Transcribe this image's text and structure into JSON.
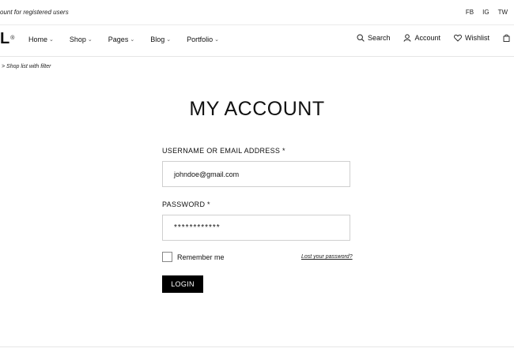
{
  "topbar": {
    "promo": "ount for registered users",
    "social": [
      "FB",
      "IG",
      "TW"
    ]
  },
  "header": {
    "logo": "L",
    "logo_mark": "®",
    "nav": [
      "Home",
      "Shop",
      "Pages",
      "Blog",
      "Portfolio"
    ],
    "chevron": "⌄",
    "search_label": "Search",
    "account_label": "Account",
    "wishlist_label": "Wishlist"
  },
  "breadcrumb": "> Shop list with filter",
  "form": {
    "title": "MY ACCOUNT",
    "username_label": "USERNAME OR EMAIL ADDRESS *",
    "username_value": "johndoe@gmail.com",
    "password_label": "PASSWORD *",
    "password_value": "************",
    "remember_label": "Remember me",
    "lost_password": "Lost your password?",
    "login_label": "LOGIN"
  },
  "icons": {
    "search": "search-icon",
    "account": "user-icon",
    "wishlist": "heart-icon",
    "cart": "bag-icon"
  }
}
